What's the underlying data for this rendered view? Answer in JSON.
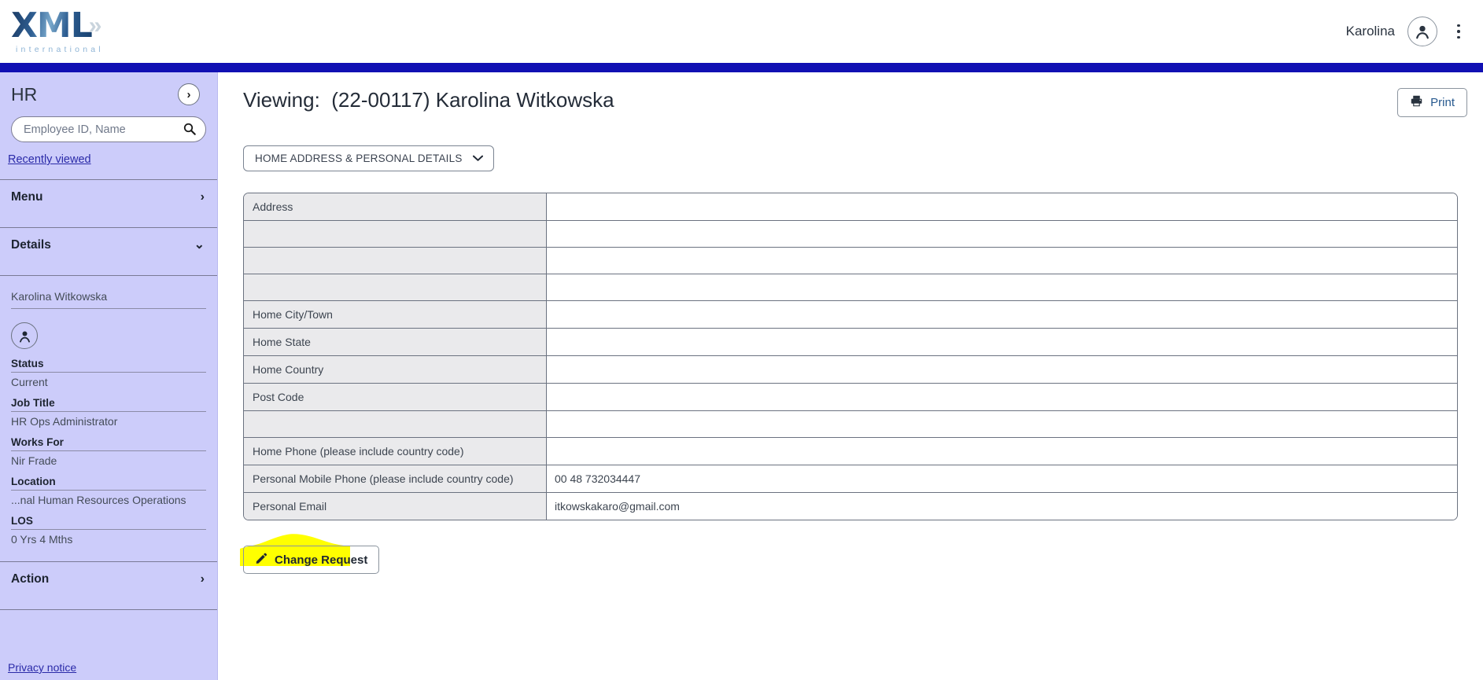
{
  "header": {
    "logo_main": "XML",
    "logo_chevrons": "»",
    "logo_sub": "international",
    "user_name": "Karolina",
    "avatar_icon": "user-icon",
    "menu_icon": "kebab-menu-icon",
    "accent_blue": "#1110b3"
  },
  "sidebar": {
    "title": "HR",
    "expand_icon": "chevron-right-icon",
    "search": {
      "placeholder": "Employee ID, Name",
      "value": "",
      "icon": "search-icon"
    },
    "recently_viewed": "Recently viewed",
    "sections": [
      {
        "label": "Menu",
        "icon": "chevron-right-icon",
        "expanded": false
      },
      {
        "label": "Details",
        "icon": "chevron-down-icon",
        "expanded": true
      },
      {
        "label": "Action",
        "icon": "chevron-right-icon",
        "expanded": false
      }
    ],
    "details": {
      "employee_name": "Karolina Witkowska",
      "avatar_icon": "user-icon",
      "fields": [
        {
          "label": "Status",
          "value": "Current"
        },
        {
          "label": "Job Title",
          "value": "HR Ops Administrator"
        },
        {
          "label": "Works For",
          "value": "Nir Frade"
        },
        {
          "label": "Location",
          "value": "...nal Human Resources Operations"
        },
        {
          "label": "LOS",
          "value": "0 Yrs 4 Mths"
        }
      ]
    },
    "privacy_notice": "Privacy notice",
    "background_color": "#ccccfa"
  },
  "main": {
    "title_prefix": "Viewing:",
    "title_value": "(22-00117) Karolina Witkowska",
    "print_button": {
      "label": "Print",
      "icon": "printer-icon"
    },
    "section_dropdown": {
      "label": "HOME ADDRESS & PERSONAL DETAILS",
      "icon": "chevron-down-icon"
    },
    "table": {
      "rows": [
        {
          "label": "Address",
          "value": ""
        },
        {
          "label": "",
          "value": ""
        },
        {
          "label": "",
          "value": ""
        },
        {
          "label": "",
          "value": ""
        },
        {
          "label": "Home City/Town",
          "value": ""
        },
        {
          "label": "Home State",
          "value": ""
        },
        {
          "label": "Home Country",
          "value": ""
        },
        {
          "label": "Post Code",
          "value": ""
        },
        {
          "label": "",
          "value": ""
        },
        {
          "label": "Home Phone (please include country code)",
          "value": ""
        },
        {
          "label": "Personal Mobile Phone (please include country code)",
          "value": "00 48 732034447"
        },
        {
          "label": "Personal Email",
          "value": "itkowskakaro@gmail.com"
        }
      ]
    },
    "change_request_button": {
      "label": "Change Request",
      "icon": "pencil-icon",
      "highlight_color": "#ffff00"
    }
  }
}
